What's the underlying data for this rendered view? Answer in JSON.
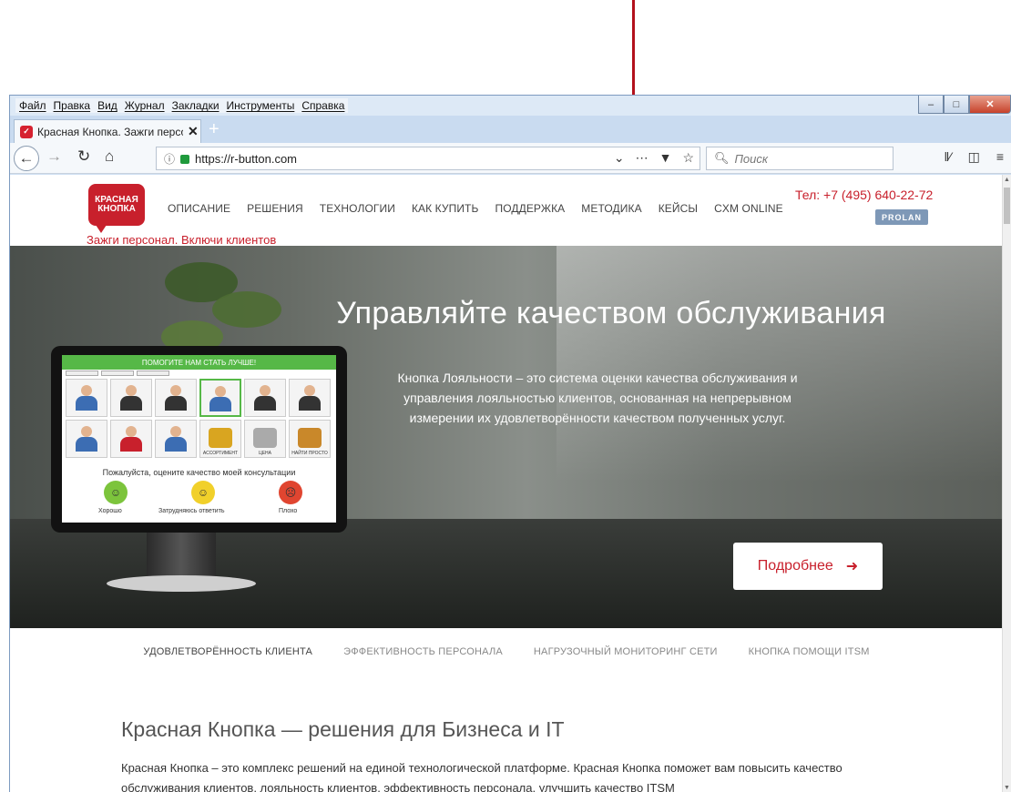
{
  "browser": {
    "menu": [
      "Файл",
      "Правка",
      "Вид",
      "Журнал",
      "Закладки",
      "Инструменты",
      "Справка"
    ],
    "tab_title": "Красная Кнопка. Зажги персо",
    "url": "https://r-button.com",
    "search_placeholder": "Поиск"
  },
  "site": {
    "logo_line1": "КРАСНАЯ",
    "logo_line2": "КНОПКА",
    "tagline": "Зажги персонал. Включи клиентов",
    "nav": [
      "ОПИСАНИЕ",
      "РЕШЕНИЯ",
      "ТЕХНОЛОГИИ",
      "КАК КУПИТЬ",
      "ПОДДЕРЖКА",
      "МЕТОДИКА",
      "КЕЙСЫ",
      "CXM ONLINE"
    ],
    "phone": "Тел: +7 (495) 640-22-72",
    "partner_badge": "PROLAN"
  },
  "hero": {
    "title": "Управляйте качеством обслуживания",
    "description": "Кнопка Лояльности – это система оценки качества обслуживания и управления лояльностью клиентов, основанная на непрерывном измерении их удовлетворённости качеством полученных услуг.",
    "button_label": "Подробнее",
    "screen_header": "ПОМОГИТЕ НАМ СТАТЬ ЛУЧШЕ!",
    "screen_question": "Пожалуйста, оцените качество моей консультации",
    "rating_good": "Хорошо",
    "rating_neutral": "Затрудняюсь ответить",
    "rating_bad": "Плохо",
    "tile_captions": [
      "АССОРТИМЕНТ",
      "ЦЕНА",
      "НАЙТИ ПРОСТО"
    ]
  },
  "subnav": [
    "УДОВЛЕТВОРЁННОСТЬ КЛИЕНТА",
    "ЭФФЕКТИВНОСТЬ ПЕРСОНАЛА",
    "НАГРУЗОЧНЫЙ МОНИТОРИНГ СЕТИ",
    "КНОПКА ПОМОЩИ ITSM"
  ],
  "section": {
    "title": "Красная Кнопка — решения для Бизнеса и IT",
    "text": "Красная Кнопка – это комплекс решений на единой технологической платформе. Красная Кнопка поможет вам повысить качество обслуживания клиентов, лояльность клиентов, эффективность персонала, улучшить качество ITSM"
  },
  "colors": {
    "brand_red": "#c8202c",
    "annotation_red": "#b3111c",
    "screen_green": "#56b847"
  }
}
